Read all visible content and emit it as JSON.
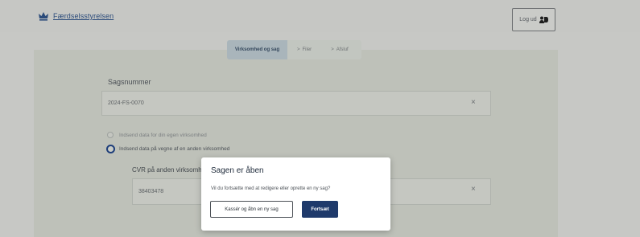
{
  "header": {
    "logo_text": "Færdselsstyrelsen",
    "login_label": "Log ud"
  },
  "stepper": {
    "steps": [
      {
        "label": "Virksomhed og sag",
        "active": true
      },
      {
        "label": "Filer",
        "active": false
      },
      {
        "label": "Afsluf",
        "active": false
      }
    ],
    "separator": ">"
  },
  "form": {
    "case_label": "Sagsnummer",
    "case_value": "2024-FS-0070",
    "clear_glyph": "×",
    "radio_own": "Indsend data for din egen virksomhed",
    "radio_other": "Indsend data på vegne af en anden virksomhed",
    "radio_selected": "radio_other",
    "cvr_label": "CVR på anden virksomhed",
    "cvr_value": "38403478"
  },
  "dialog": {
    "title": "Sagen er åben",
    "text": "Vil du fortsætte med at redigere eller oprette en ny sag?",
    "secondary_button": "Kassér og åbn en ny sag",
    "primary_button": "Fortsæt"
  },
  "colors": {
    "brand": "#1f3a6b",
    "overlay_bg": "#c7c8c5"
  }
}
